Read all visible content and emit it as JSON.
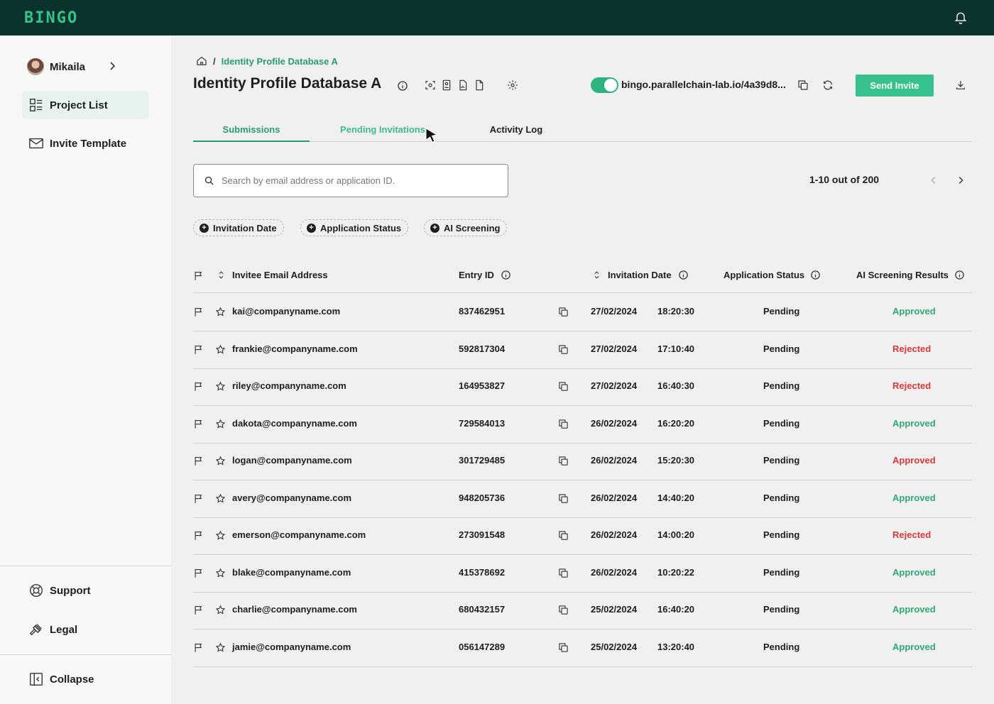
{
  "app": {
    "logo": "BINGO"
  },
  "sidebar": {
    "user_name": "Mikaila",
    "items": [
      {
        "label": "Project List",
        "icon": "grid-list-icon",
        "active": true
      },
      {
        "label": "Invite Template",
        "icon": "envelope-icon"
      }
    ],
    "bottom_items": [
      {
        "label": "Support",
        "icon": "lifebuoy-icon"
      },
      {
        "label": "Legal",
        "icon": "gavel-icon"
      }
    ],
    "collapse_label": "Collapse"
  },
  "breadcrumb": {
    "current": "Identity Profile Database A"
  },
  "page": {
    "title": "Identity Profile Database A",
    "url": "bingo.parallelchain-lab.io/4a39d8...",
    "send_invite": "Send Invite",
    "toggle_on": true
  },
  "tabs": [
    "Submissions",
    "Pending Invitations",
    "Activity Log"
  ],
  "search": {
    "placeholder": "Search by email address or application ID."
  },
  "pagination": {
    "text": "1-10 out of 200"
  },
  "filters": [
    "Invitation Date",
    "Application Status",
    "AI Screening"
  ],
  "table": {
    "headers": {
      "email": "Invitee Email Address",
      "entry": "Entry ID",
      "date": "Invitation Date",
      "status": "Application Status",
      "ai": "AI Screening Results"
    },
    "rows": [
      {
        "email": "kai@companyname.com",
        "entry": "837462951",
        "date": "27/02/2024",
        "time": "18:20:30",
        "status": "Pending",
        "ai": "Approved",
        "ai_color": "#2fa874"
      },
      {
        "email": "frankie@companyname.com",
        "entry": "592817304",
        "date": "27/02/2024",
        "time": "17:10:40",
        "status": "Pending",
        "ai": "Rejected",
        "ai_color": "#d8383a"
      },
      {
        "email": "riley@companyname.com",
        "entry": "164953827",
        "date": "27/02/2024",
        "time": "16:40:30",
        "status": "Pending",
        "ai": "Rejected",
        "ai_color": "#d8383a"
      },
      {
        "email": "dakota@companyname.com",
        "entry": "729584013",
        "date": "26/02/2024",
        "time": "16:20:20",
        "status": "Pending",
        "ai": "Approved",
        "ai_color": "#2fa874"
      },
      {
        "email": "logan@companyname.com",
        "entry": "301729485",
        "date": "26/02/2024",
        "time": "15:20:30",
        "status": "Pending",
        "ai": "Approved",
        "ai_color": "#d8383a"
      },
      {
        "email": "avery@companyname.com",
        "entry": "948205736",
        "date": "26/02/2024",
        "time": "14:40:20",
        "status": "Pending",
        "ai": "Approved",
        "ai_color": "#2fa874"
      },
      {
        "email": "emerson@companyname.com",
        "entry": "273091548",
        "date": "26/02/2024",
        "time": "14:00:20",
        "status": "Pending",
        "ai": "Rejected",
        "ai_color": "#d8383a"
      },
      {
        "email": "blake@companyname.com",
        "entry": "415378692",
        "date": "26/02/2024",
        "time": "10:20:22",
        "status": "Pending",
        "ai": "Approved",
        "ai_color": "#2fa874"
      },
      {
        "email": "charlie@companyname.com",
        "entry": "680432157",
        "date": "25/02/2024",
        "time": "16:40:20",
        "status": "Pending",
        "ai": "Approved",
        "ai_color": "#2fa874"
      },
      {
        "email": "jamie@companyname.com",
        "entry": "056147289",
        "date": "25/02/2024",
        "time": "13:20:40",
        "status": "Pending",
        "ai": "Approved",
        "ai_color": "#2fa874"
      }
    ]
  },
  "colors": {
    "brand": "#36c18e",
    "topbar": "#0b332c",
    "approved": "#2fa874",
    "rejected": "#d8383a"
  }
}
